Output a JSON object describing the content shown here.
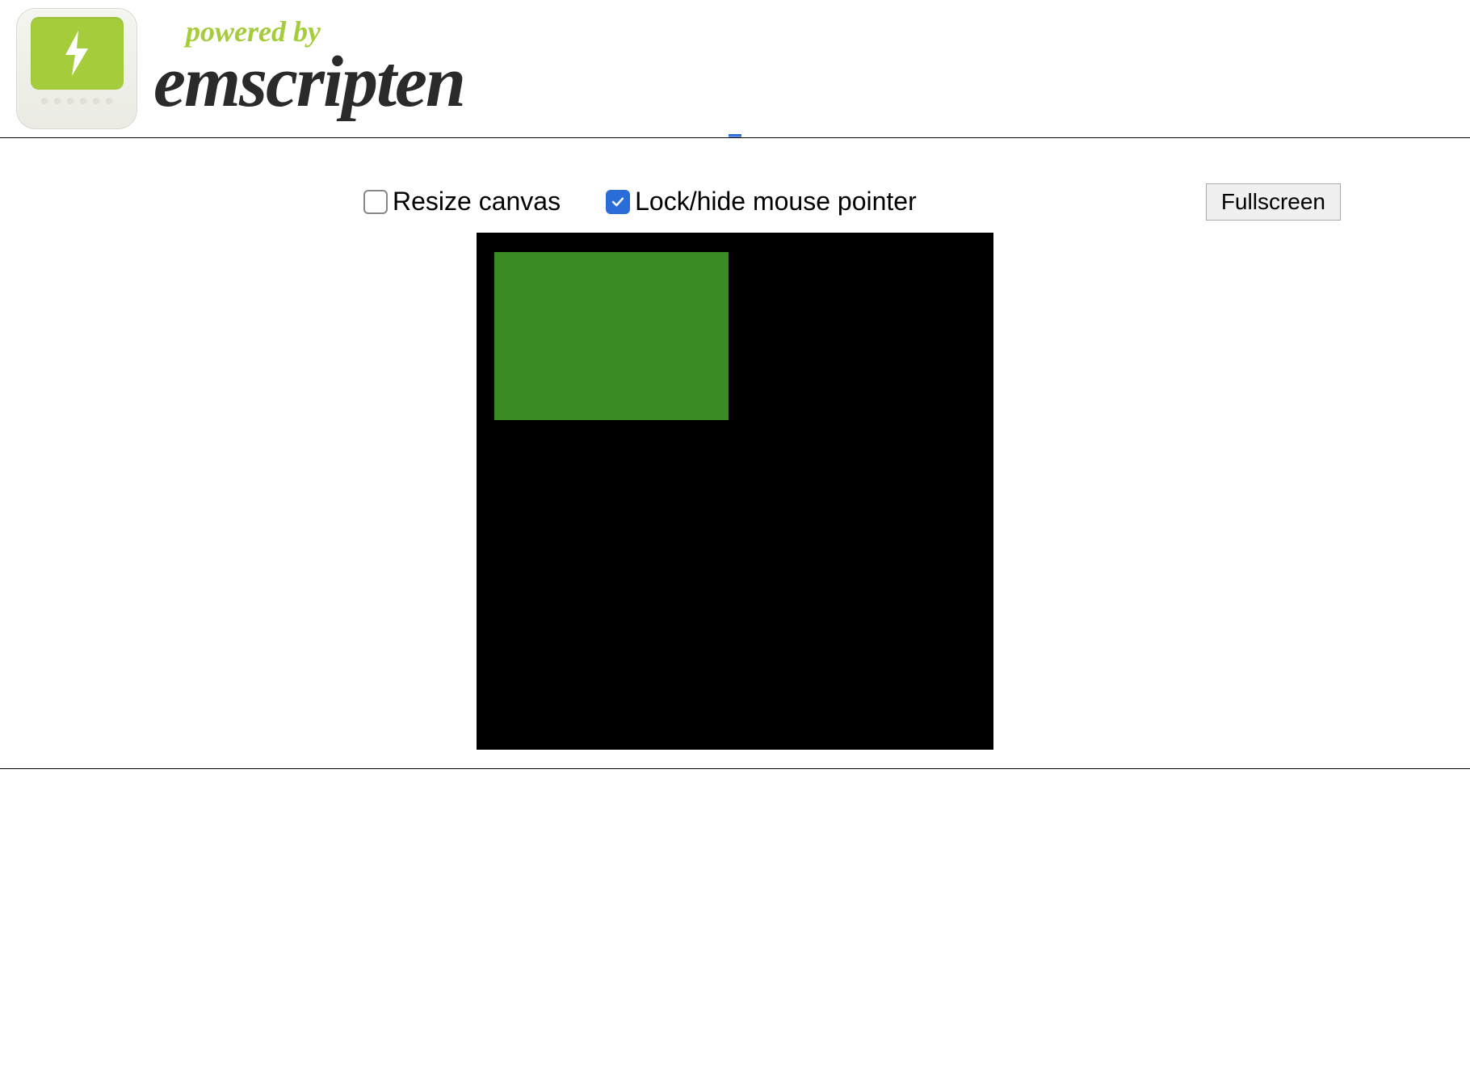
{
  "header": {
    "powered_by": "powered by",
    "brand": "emscripten"
  },
  "controls": {
    "resize_canvas": {
      "label": "Resize canvas",
      "checked": false
    },
    "lock_pointer": {
      "label": "Lock/hide mouse pointer",
      "checked": true
    },
    "fullscreen_label": "Fullscreen"
  },
  "canvas": {
    "background": "#000000",
    "rect_color": "#3a8b24"
  }
}
